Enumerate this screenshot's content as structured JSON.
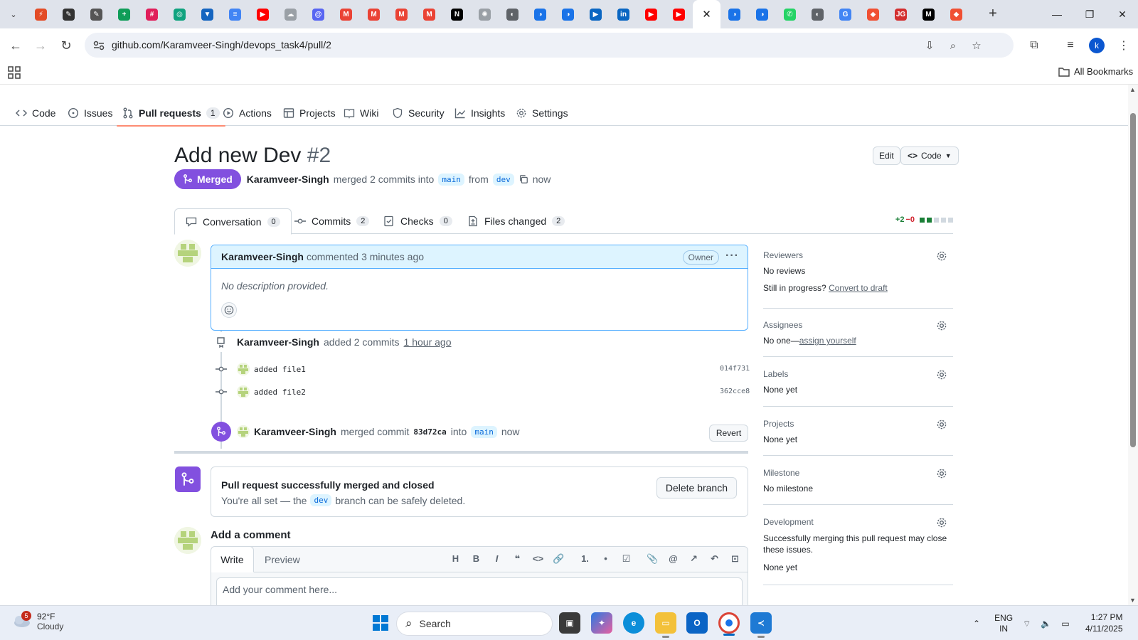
{
  "browser": {
    "tabs": [
      {
        "icon": "zap-icon",
        "color": "#e34c26",
        "glyph": "⚡"
      },
      {
        "icon": "pen-icon",
        "color": "#333333",
        "glyph": "✎"
      },
      {
        "icon": "pen-icon",
        "color": "#555555",
        "glyph": "✎"
      },
      {
        "icon": "sheets-icon",
        "color": "#0f9d58",
        "glyph": "+"
      },
      {
        "icon": "slack-icon",
        "color": "#e01e5a",
        "glyph": "#"
      },
      {
        "icon": "chatgpt-icon",
        "color": "#10a37f",
        "glyph": "◎"
      },
      {
        "icon": "shield-icon",
        "color": "#1565c0",
        "glyph": "▼"
      },
      {
        "icon": "docs-icon",
        "color": "#4285f4",
        "glyph": "≡"
      },
      {
        "icon": "youtube-icon",
        "color": "#ff0000",
        "glyph": "▶"
      },
      {
        "icon": "cloud-icon",
        "color": "#9aa0a6",
        "glyph": "☁"
      },
      {
        "icon": "threads-icon",
        "color": "#5865f2",
        "glyph": "@"
      },
      {
        "icon": "gmail-icon",
        "color": "#ea4335",
        "glyph": "M"
      },
      {
        "icon": "gmail-icon",
        "color": "#ea4335",
        "glyph": "M"
      },
      {
        "icon": "gmail-icon",
        "color": "#ea4335",
        "glyph": "M"
      },
      {
        "icon": "gmail-icon",
        "color": "#ea4335",
        "glyph": "M"
      },
      {
        "icon": "notion-icon",
        "color": "#000000",
        "glyph": "N"
      },
      {
        "icon": "settings-icon",
        "color": "#9aa0a6",
        "glyph": "✺"
      },
      {
        "icon": "globe-icon",
        "color": "#5f6368",
        "glyph": "◐"
      },
      {
        "icon": "edge-icon",
        "color": "#1a73e8",
        "glyph": "◑"
      },
      {
        "icon": "edge-icon",
        "color": "#1a73e8",
        "glyph": "◑"
      },
      {
        "icon": "video-icon",
        "color": "#0a66c2",
        "glyph": "▶"
      },
      {
        "icon": "linkedin-icon",
        "color": "#0a66c2",
        "glyph": "in"
      },
      {
        "icon": "youtube-icon",
        "color": "#ff0000",
        "glyph": "▶"
      },
      {
        "icon": "youtube-icon",
        "color": "#ff0000",
        "glyph": "▶"
      },
      {
        "icon": "close-icon",
        "color": "#222222",
        "glyph": "✕",
        "active": true
      },
      {
        "icon": "edge-icon",
        "color": "#1a73e8",
        "glyph": "◑"
      },
      {
        "icon": "edge-icon",
        "color": "#1a73e8",
        "glyph": "◑"
      },
      {
        "icon": "whatsapp-icon",
        "color": "#25d366",
        "glyph": "✆"
      },
      {
        "icon": "globe-icon",
        "color": "#5f6368",
        "glyph": "◐"
      },
      {
        "icon": "google-icon",
        "color": "#4285f4",
        "glyph": "G"
      },
      {
        "icon": "diamond-icon",
        "color": "#f05033",
        "glyph": "◆"
      },
      {
        "icon": "jg-icon",
        "color": "#d32f2f",
        "glyph": "JG"
      },
      {
        "icon": "medium-icon",
        "color": "#000000",
        "glyph": "M"
      },
      {
        "icon": "diamond-icon",
        "color": "#f05033",
        "glyph": "◆"
      }
    ],
    "url": "github.com/Karamveer-Singh/devops_task4/pull/2",
    "profile_initial": "k",
    "all_bookmarks": "All Bookmarks"
  },
  "repo_nav": {
    "items": [
      {
        "label": "Code",
        "icon": "code-icon"
      },
      {
        "label": "Issues",
        "icon": "issue-icon"
      },
      {
        "label": "Pull requests",
        "icon": "pull-request-icon",
        "count": "1",
        "selected": true
      },
      {
        "label": "Actions",
        "icon": "play-icon"
      },
      {
        "label": "Projects",
        "icon": "table-icon"
      },
      {
        "label": "Wiki",
        "icon": "book-icon"
      },
      {
        "label": "Security",
        "icon": "shield-icon"
      },
      {
        "label": "Insights",
        "icon": "graph-icon"
      },
      {
        "label": "Settings",
        "icon": "gear-icon"
      }
    ]
  },
  "pr": {
    "title": "Add new Dev",
    "number": "#2",
    "edit_label": "Edit",
    "code_label": "Code",
    "state": "Merged",
    "author": "Karamveer-Singh",
    "merge_text": "merged 2 commits into",
    "base": "main",
    "from_text": "from",
    "head": "dev",
    "time": "now"
  },
  "pr_tabs": [
    {
      "label": "Conversation",
      "count": "0",
      "icon": "comment-icon",
      "selected": true
    },
    {
      "label": "Commits",
      "count": "2",
      "icon": "commit-icon"
    },
    {
      "label": "Checks",
      "count": "0",
      "icon": "checklist-icon"
    },
    {
      "label": "Files changed",
      "count": "2",
      "icon": "file-diff-icon"
    }
  ],
  "diffstat": {
    "additions": "+2",
    "deletions": "−0",
    "colors": [
      "#1a7f37",
      "#1a7f37",
      "#d1d9e0",
      "#d1d9e0",
      "#d1d9e0"
    ]
  },
  "comment": {
    "author": "Karamveer-Singh",
    "action": "commented",
    "time": "3 minutes ago",
    "role": "Owner",
    "body": "No description provided."
  },
  "timeline": {
    "commits_event": {
      "author": "Karamveer-Singh",
      "action": "added 2 commits",
      "time": "1 hour ago"
    },
    "commits": [
      {
        "message": "added file1",
        "sha": "014f731"
      },
      {
        "message": "added file2",
        "sha": "362cce8"
      }
    ],
    "merge_event": {
      "author": "Karamveer-Singh",
      "action": "merged commit",
      "sha": "83d72ca",
      "into": "into",
      "base": "main",
      "time": "now",
      "revert": "Revert"
    }
  },
  "merged_box": {
    "heading": "Pull request successfully merged and closed",
    "prefix": "You're all set — the",
    "branch": "dev",
    "suffix": "branch can be safely deleted.",
    "delete_label": "Delete branch"
  },
  "add_comment": {
    "title": "Add a comment",
    "write": "Write",
    "preview": "Preview",
    "tools": [
      "H",
      "B",
      "I",
      "❝",
      "<>",
      "🔗",
      "1.",
      "•",
      "☑",
      "📎",
      "@",
      "↗",
      "↶",
      "⊡"
    ],
    "placeholder": "Add your comment here..."
  },
  "sidebar": {
    "reviewers": {
      "title": "Reviewers",
      "value": "No reviews",
      "progress_text": "Still in progress?",
      "progress_link": "Convert to draft"
    },
    "assignees": {
      "title": "Assignees",
      "value": "No one—",
      "link": "assign yourself"
    },
    "labels": {
      "title": "Labels",
      "value": "None yet"
    },
    "projects": {
      "title": "Projects",
      "value": "None yet"
    },
    "milestone": {
      "title": "Milestone",
      "value": "No milestone"
    },
    "development": {
      "title": "Development",
      "desc": "Successfully merging this pull request may close these issues.",
      "value": "None yet"
    }
  },
  "taskbar": {
    "weather_badge": "5",
    "temp": "92°F",
    "condition": "Cloudy",
    "search": "Search",
    "lang1": "ENG",
    "lang2": "IN",
    "time": "1:27 PM",
    "date": "4/11/2025"
  }
}
